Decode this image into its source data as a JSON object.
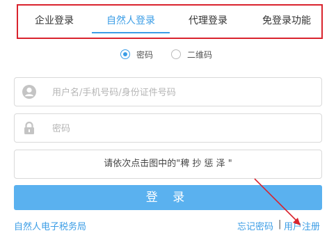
{
  "tabs": [
    {
      "label": "企业登录",
      "active": false
    },
    {
      "label": "自然人登录",
      "active": true
    },
    {
      "label": "代理登录",
      "active": false
    },
    {
      "label": "免登录功能",
      "active": false
    }
  ],
  "login_method": {
    "options": [
      {
        "label": "密码",
        "checked": true
      },
      {
        "label": "二维码",
        "checked": false
      }
    ]
  },
  "username_field": {
    "placeholder": "用户名/手机号码/身份证件号码",
    "value": "",
    "icon": "user-icon"
  },
  "password_field": {
    "placeholder": "密码",
    "value": "",
    "icon": "lock-icon"
  },
  "captcha": {
    "prompt": "请依次点击图中的\"稗 抄 惩 泽 \""
  },
  "login_button": {
    "label": "登 录"
  },
  "footer": {
    "left_link": "自然人电子税务局",
    "forgot_password": "忘记密码",
    "separator": "|",
    "register": "用户注册"
  },
  "colors": {
    "accent": "#3b9de6",
    "highlight_box": "#d9232d",
    "annotation_arrow": "#d9232d",
    "button": "#5ab1ef"
  }
}
